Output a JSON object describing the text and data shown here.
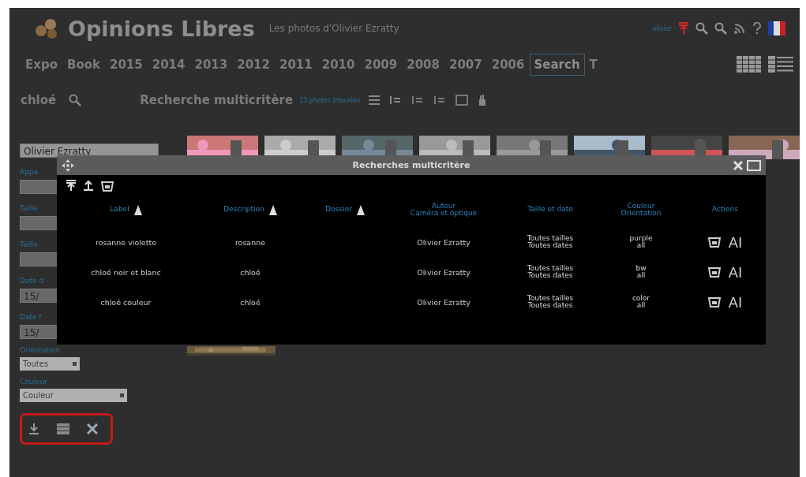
{
  "header": {
    "title": "Opinions Libres",
    "subtitle": "Les photos d'Olivier Ezratty",
    "user": "olivier"
  },
  "nav": [
    {
      "label": "Expo",
      "selected": false
    },
    {
      "label": "Book",
      "selected": false
    },
    {
      "label": "2015",
      "selected": false
    },
    {
      "label": "2014",
      "selected": false
    },
    {
      "label": "2013",
      "selected": false
    },
    {
      "label": "2012",
      "selected": false
    },
    {
      "label": "2011",
      "selected": false
    },
    {
      "label": "2010",
      "selected": false
    },
    {
      "label": "2009",
      "selected": false
    },
    {
      "label": "2008",
      "selected": false
    },
    {
      "label": "2007",
      "selected": false
    },
    {
      "label": "2006",
      "selected": false
    },
    {
      "label": "Search",
      "selected": true
    },
    {
      "label": "T",
      "selected": false
    }
  ],
  "search": {
    "value": "chloé"
  },
  "results": {
    "title": "Recherche multicritère",
    "count": "13 photos trouvées"
  },
  "sidebar": {
    "fields": [
      {
        "kind": "text",
        "value": "Olivier Ezratty"
      },
      {
        "kind": "text",
        "label": "Appa"
      },
      {
        "kind": "text",
        "label": "Taille"
      },
      {
        "kind": "text",
        "label": "Taille"
      },
      {
        "kind": "text",
        "label": "Date d",
        "value": "15/"
      },
      {
        "kind": "text",
        "label": "Date f",
        "value": "15/"
      },
      {
        "kind": "select",
        "label": "Orientation",
        "value": "Toutes"
      },
      {
        "kind": "select",
        "label": "Couleur",
        "value": "Couleur"
      }
    ]
  },
  "dialog": {
    "title": "Recherches multicritère",
    "columns": [
      {
        "label": "Label",
        "sortable": true
      },
      {
        "label": "Description",
        "sortable": true
      },
      {
        "label": "Dossier",
        "sortable": true
      },
      {
        "label": "Auteur\nCaméra et optique",
        "sortable": false
      },
      {
        "label": "Taille et date",
        "sortable": false
      },
      {
        "label": "Couleur\nOrientation",
        "sortable": false
      },
      {
        "label": "Actions",
        "sortable": false
      }
    ],
    "rows": [
      {
        "label": "rosanne violette",
        "description": "rosanne",
        "author": "Olivier Ezratty",
        "size": "Toutes tailles",
        "date": "Toutes dates",
        "colour_mode": "purple",
        "orientation": "all",
        "action": "AI"
      },
      {
        "label": "chloé noir et blanc",
        "description": "chloé",
        "author": "Olivier Ezratty",
        "size": "Toutes tailles",
        "date": "Toutes dates",
        "colour_mode": "bw",
        "orientation": "all",
        "action": "AI"
      },
      {
        "label": "chloé couleur",
        "description": "chloé",
        "author": "Olivier Ezratty",
        "size": "Toutes tailles",
        "date": "Toutes dates",
        "colour_mode": "color",
        "orientation": "all",
        "action": "AI"
      }
    ]
  }
}
